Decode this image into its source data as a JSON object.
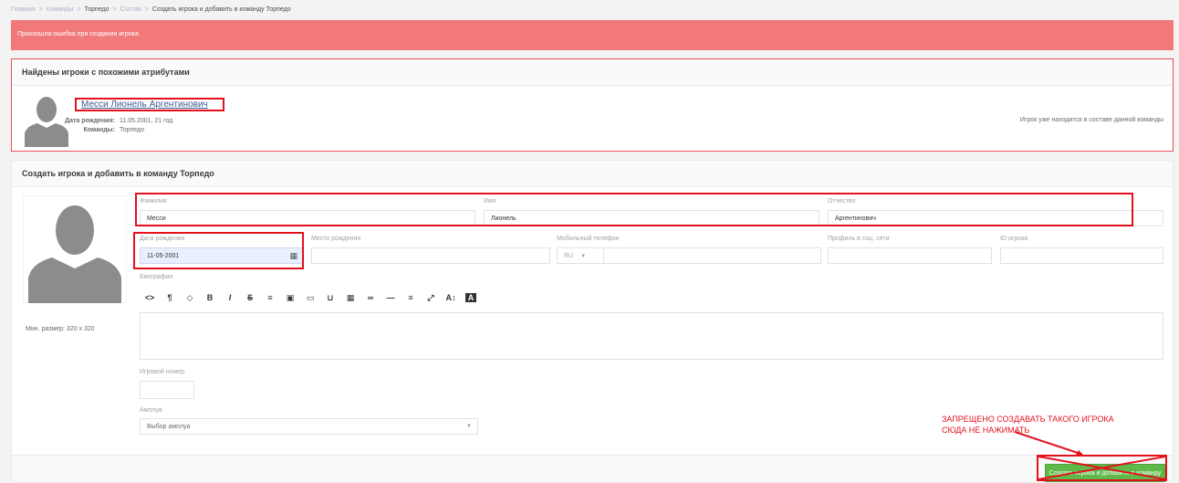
{
  "breadcrumb": {
    "home": "Главная",
    "teams": "Команды",
    "team": "Торпедо",
    "roster": "Состав",
    "current": "Создать игрока и добавить в команду Торпедо",
    "separator": ">"
  },
  "alert": {
    "message": "Произошла ошибка при создании игрока",
    "color": "#f2797a"
  },
  "similar": {
    "title": "Найдены игроки с похожими атрибутами",
    "player": {
      "name": "Месси Лионель Аргентинович",
      "birth_label": "Дата рождения:",
      "birth_value": "11.05.2001, 21 год",
      "teams_label": "Команды:",
      "teams_value": "Торпедо"
    },
    "note": "Игрок уже находится в составе данной команды"
  },
  "form": {
    "title": "Создать игрока и добавить в команду Торпедо",
    "min_size": "Мин. размер: 320 x 320",
    "last_name": {
      "label": "Фамилия",
      "value": "Месси"
    },
    "first_name": {
      "label": "Имя",
      "value": "Лионель"
    },
    "patronymic": {
      "label": "Отчество",
      "value": "Аргентинович"
    },
    "birth_date": {
      "label": "Дата рождения",
      "value": "11-05-2001"
    },
    "birth_place": {
      "label": "Место рождения",
      "value": ""
    },
    "phone": {
      "label": "Мобильный телефон",
      "code": "RU",
      "value": ""
    },
    "social": {
      "label": "Профиль в соц. сети",
      "value": ""
    },
    "player_id": {
      "label": "ID игрока",
      "value": ""
    },
    "bio": {
      "label": "Биография"
    },
    "number": {
      "label": "Игровой номер",
      "value": ""
    },
    "position": {
      "label": "Амплуа",
      "placeholder": "Выбор амплуа"
    },
    "submit": "Создать игрока и добавить в команду"
  },
  "toolbar": [
    {
      "name": "code-view-icon",
      "glyph": "<>"
    },
    {
      "name": "paragraph-icon",
      "glyph": "¶"
    },
    {
      "name": "color-drop-icon",
      "glyph": "◇"
    },
    {
      "name": "bold-icon",
      "glyph": "B"
    },
    {
      "name": "italic-icon",
      "glyph": "I"
    },
    {
      "name": "strikethrough-icon",
      "glyph": "S"
    },
    {
      "name": "list-icon",
      "glyph": "≡"
    },
    {
      "name": "image-icon",
      "glyph": "▣"
    },
    {
      "name": "video-icon",
      "glyph": "▭"
    },
    {
      "name": "upload-icon",
      "glyph": "⊔"
    },
    {
      "name": "table-icon",
      "glyph": "▦"
    },
    {
      "name": "link-icon",
      "glyph": "∞"
    },
    {
      "name": "horizontal-rule-icon",
      "glyph": "—"
    },
    {
      "name": "align-icon",
      "glyph": "≡"
    },
    {
      "name": "fullscreen-icon",
      "glyph": "⤢"
    },
    {
      "name": "font-size-icon",
      "glyph": "A↕"
    },
    {
      "name": "text-color-icon",
      "glyph": "A"
    }
  ],
  "annotation": {
    "line1": "ЗАПРЕЩЕНО СОЗДАВАТЬ ТАКОГО ИГРОКА",
    "line2": "СЮДА НЕ НАЖИМАТЬ",
    "color": "#e4111d"
  }
}
